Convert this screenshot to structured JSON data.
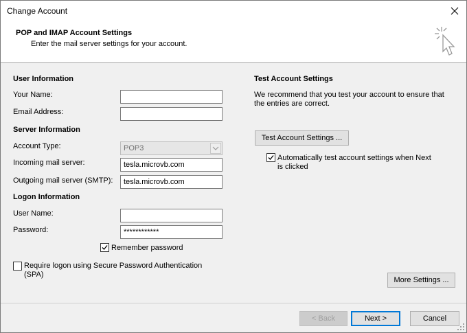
{
  "window": {
    "title": "Change Account"
  },
  "header": {
    "title": "POP and IMAP Account Settings",
    "subtitle": "Enter the mail server settings for your account."
  },
  "left": {
    "user_info_heading": "User Information",
    "your_name_label": "Your Name:",
    "your_name_value": "",
    "email_label": "Email Address:",
    "email_value": "",
    "server_info_heading": "Server Information",
    "account_type_label": "Account Type:",
    "account_type_value": "POP3",
    "incoming_label": "Incoming mail server:",
    "incoming_value": "tesla.microvb.com",
    "outgoing_label": "Outgoing mail server (SMTP):",
    "outgoing_value": "tesla.microvb.com",
    "logon_heading": "Logon Information",
    "username_label": "User Name:",
    "username_value": "",
    "password_label": "Password:",
    "password_value": "************",
    "remember_label": "Remember password",
    "remember_checked": true,
    "spa_label_line1": "Require logon using Secure Password Authentication",
    "spa_label_line2": "(SPA)",
    "spa_checked": false
  },
  "right": {
    "test_heading": "Test Account Settings",
    "test_desc_line1": "We recommend that you test your account to ensure that",
    "test_desc_line2": "the entries are correct.",
    "test_button": "Test Account Settings ...",
    "auto_test_line1": "Automatically test account settings when Next",
    "auto_test_line2": "is clicked",
    "auto_test_checked": true,
    "more_settings_button": "More Settings ..."
  },
  "footer": {
    "back_button": "< Back",
    "next_button": "Next >",
    "cancel_button": "Cancel"
  },
  "colors": {
    "accent": "#0078d7"
  },
  "icons": {
    "close": "close-icon",
    "dropdown": "chevron-down-icon",
    "checkmark": "checkmark-icon",
    "header_art": "cursor-sparkle-icon"
  }
}
